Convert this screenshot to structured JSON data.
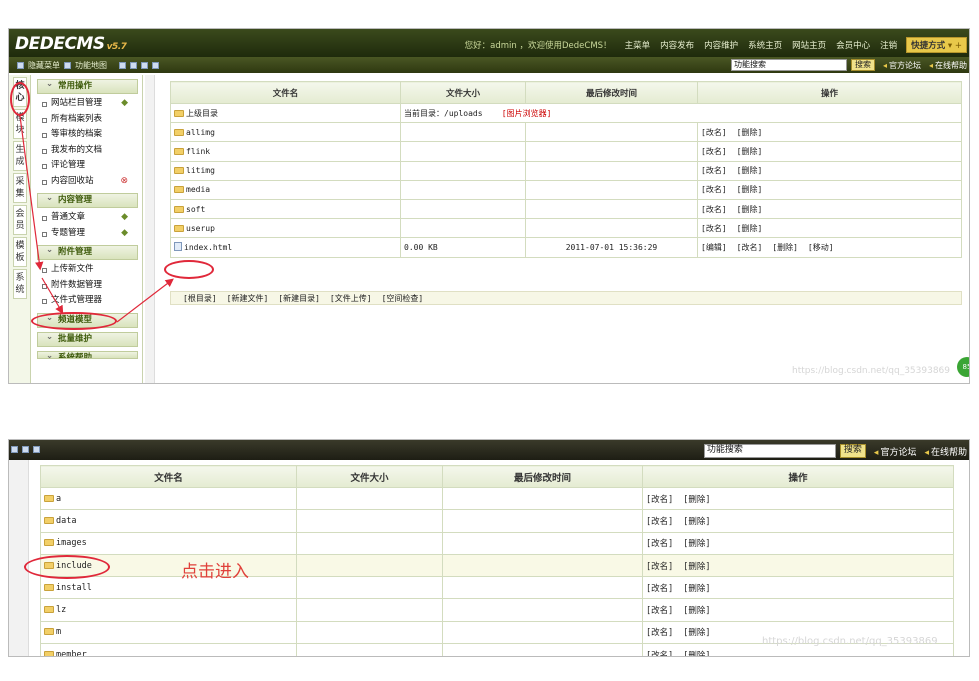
{
  "top": {
    "logo": "DEDECMS",
    "version": "v5.7",
    "welcome": "您好：admin ，欢迎使用DedeCMS！",
    "nav": [
      "主菜单",
      "内容发布",
      "内容维护",
      "系统主页",
      "网站主页",
      "会员中心",
      "注销"
    ],
    "quick": "快捷方式",
    "bar_left": [
      "隐藏菜单",
      "功能地图"
    ],
    "search_value": "功能搜索",
    "search_btn": "搜索",
    "forum": "官方论坛",
    "help": "在线帮助",
    "side_tabs": [
      "核心",
      "模块",
      "生成",
      "采集",
      "会员",
      "模板",
      "系统"
    ],
    "menu_groups": [
      {
        "title": "常用操作",
        "items": [
          "网站栏目管理",
          "所有档案列表",
          "等审核的档案",
          "我发布的文档",
          "评论管理",
          "内容回收站"
        ]
      },
      {
        "title": "内容管理",
        "items": [
          "普通文章",
          "专题管理"
        ]
      },
      {
        "title": "附件管理",
        "items": [
          "上传新文件",
          "附件数据管理",
          "文件式管理器"
        ]
      },
      {
        "title": "频道模型",
        "items": []
      },
      {
        "title": "批量维护",
        "items": []
      },
      {
        "title": "系统帮助",
        "items": []
      }
    ],
    "table_headers": [
      "文件名",
      "文件大小",
      "最后修改时间",
      "操作"
    ],
    "up_row": {
      "name": "上级目录",
      "path": "当前目录：/uploads",
      "browser": "[图片浏览器]"
    },
    "folders": [
      "allimg",
      "flink",
      "litimg",
      "media",
      "soft",
      "userup"
    ],
    "folder_ops": [
      "[改名]",
      "[删除]"
    ],
    "file_row": {
      "name": "index.html",
      "size": "0.00 KB",
      "time": "2011-07-01 15:36:29",
      "ops": [
        "[编辑]",
        "[改名]",
        "[删除]",
        "[移动]"
      ]
    },
    "actions": [
      "[根目录]",
      "[新建文件]",
      "[新建目录]",
      "[文件上传]",
      "[空间检查]"
    ],
    "watermark": "https://blog.csdn.net/qq_35393869",
    "badge": "85"
  },
  "bottom": {
    "search_value": "功能搜索",
    "search_btn": "搜索",
    "forum": "官方论坛",
    "help": "在线帮助",
    "table_headers": [
      "文件名",
      "文件大小",
      "最后修改时间",
      "操作"
    ],
    "folders": [
      "a",
      "data",
      "images",
      "include",
      "install",
      "lz",
      "m",
      "member"
    ],
    "folder_ops": [
      "[改名]",
      "[删除]"
    ],
    "note": "点击进入",
    "watermark": "https://blog.csdn.net/qq_35393869"
  },
  "colors": {
    "annotation": "#e0283a",
    "header": "#2c3a12",
    "accent": "#e8c84a"
  }
}
